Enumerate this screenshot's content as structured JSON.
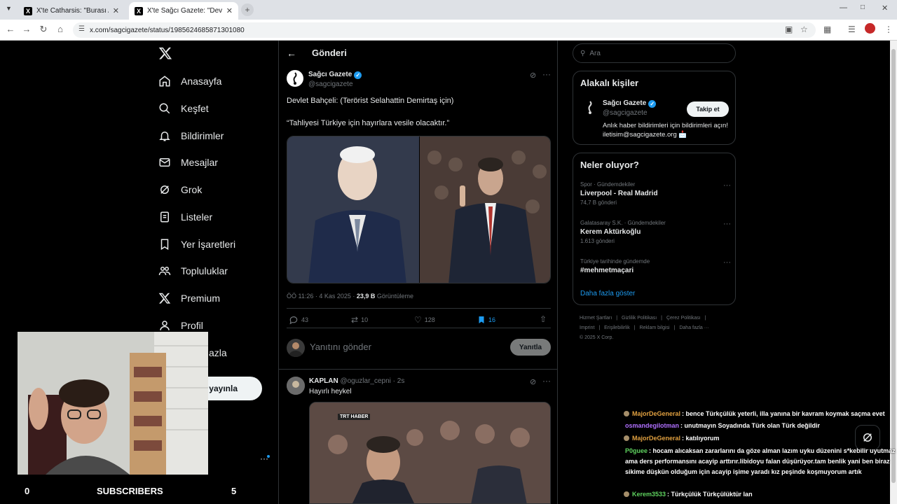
{
  "browser": {
    "tabs": [
      {
        "title": "X'te Catharsis: \"Burası Almanya",
        "active": false
      },
      {
        "title": "X'te Sağcı Gazete: \"Devlet Bahç",
        "active": true
      }
    ],
    "url": "x.com/sagcigazete/status/1985624685871301080"
  },
  "nav": {
    "items": [
      {
        "label": "Anasayfa",
        "icon": "home-icon"
      },
      {
        "label": "Keşfet",
        "icon": "search-icon"
      },
      {
        "label": "Bildirimler",
        "icon": "bell-icon"
      },
      {
        "label": "Mesajlar",
        "icon": "mail-icon"
      },
      {
        "label": "Grok",
        "icon": "grok-icon"
      },
      {
        "label": "Listeler",
        "icon": "list-icon"
      },
      {
        "label": "Yer İşaretleri",
        "icon": "bookmark-icon"
      },
      {
        "label": "Topluluklar",
        "icon": "communities-icon"
      },
      {
        "label": "Premium",
        "icon": "x-icon"
      },
      {
        "label": "Profil",
        "icon": "profile-icon"
      },
      {
        "label": "azla",
        "icon": "more-icon"
      }
    ],
    "post_button": "yayınla"
  },
  "post": {
    "header_title": "Gönderi",
    "author_name": "Sağcı Gazete",
    "author_handle": "@sagcigazete",
    "text_line1": "Devlet Bahçeli: (Terörist Selahattin Demirtaş için)",
    "text_line2": "“Tahliyesi Türkiye için hayırlara vesile olacaktır.”",
    "meta_time": "ÖÖ 11:26 · 4 Kas 2025 · ",
    "meta_views_count": "23,9 B",
    "meta_views_label": " Görüntüleme",
    "replies": "43",
    "reposts": "10",
    "likes": "128",
    "bookmarks": "16",
    "reply_placeholder": "Yanıtını gönder",
    "reply_button": "Yanıtla"
  },
  "reply_post": {
    "author_name": "KAPLAN",
    "author_handle": "@oguzlar_cepni",
    "time": "· 2s",
    "text": "Hayırlı heykel",
    "video_logo": "TRT HABER"
  },
  "sidebar": {
    "search_placeholder": "Ara",
    "related_title": "Alakalı kişiler",
    "related_person": {
      "name": "Sağcı Gazete",
      "handle": "@sagcigazete",
      "bio": "Anlık haber bildirimleri için bildirimleri açın! iletisim@sagcigazete.org 📩",
      "follow": "Takip et"
    },
    "trends_title": "Neler oluyor?",
    "trends": [
      {
        "meta": "Spor · Gündemdekiler",
        "name": "Liverpool - Real Madrid",
        "count": "74,7 B gönderi"
      },
      {
        "meta": "Galatasaray S.K. · Gündemdekiler",
        "name": "Kerem Aktürkoğlu",
        "count": "1.613 gönderi"
      },
      {
        "meta": "Türkiye tarihinde gündemde",
        "name": "#mehmetmaçari",
        "count": ""
      }
    ],
    "show_more": "Daha fazla göster",
    "footer_links": [
      "Hizmet Şartları",
      "Gizlilik Politikası",
      "Çerez Politikası",
      "Imprint",
      "Erişilebilirlik",
      "Reklam bilgisi",
      "Daha fazla ···"
    ],
    "copyright": "© 2025 X Corp."
  },
  "stream_overlay": {
    "left_count": "0",
    "label": "SUBSCRIBERS",
    "right_count": "5"
  },
  "chat": [
    {
      "user": "MajorDeGeneral",
      "color": "#e0a040",
      "badge": true,
      "msg": ": bence Türkçülük yeterli, illa yanına bir kavram koymak saçma evet"
    },
    {
      "user": "osmandegilotman",
      "color": "#b070ff",
      "badge": false,
      "msg": ": unutmayın Soyadında Türk olan Türk değildir"
    },
    {
      "user": "MajorDeGeneral",
      "color": "#e0a040",
      "badge": true,
      "msg": ": katılıyorum"
    },
    {
      "user": "P0guee",
      "color": "#5fd35f",
      "badge": false,
      "msg": ": hocam alıcaksan zararlarını da göze alman lazım uyku düzenini s*kebilir uyutmaz ama ders performansını acayip arttırır.libidoyu falan düşürüyor.tam benlik yani ben biraz sikime düşkün olduğum için acayip işime yaradı kız peşinde koşmuyorum artık"
    },
    {
      "user": "Kerem3533",
      "color": "#5fd35f",
      "badge": true,
      "msg": ": Türkçülük Türkçülüktür lan"
    }
  ]
}
